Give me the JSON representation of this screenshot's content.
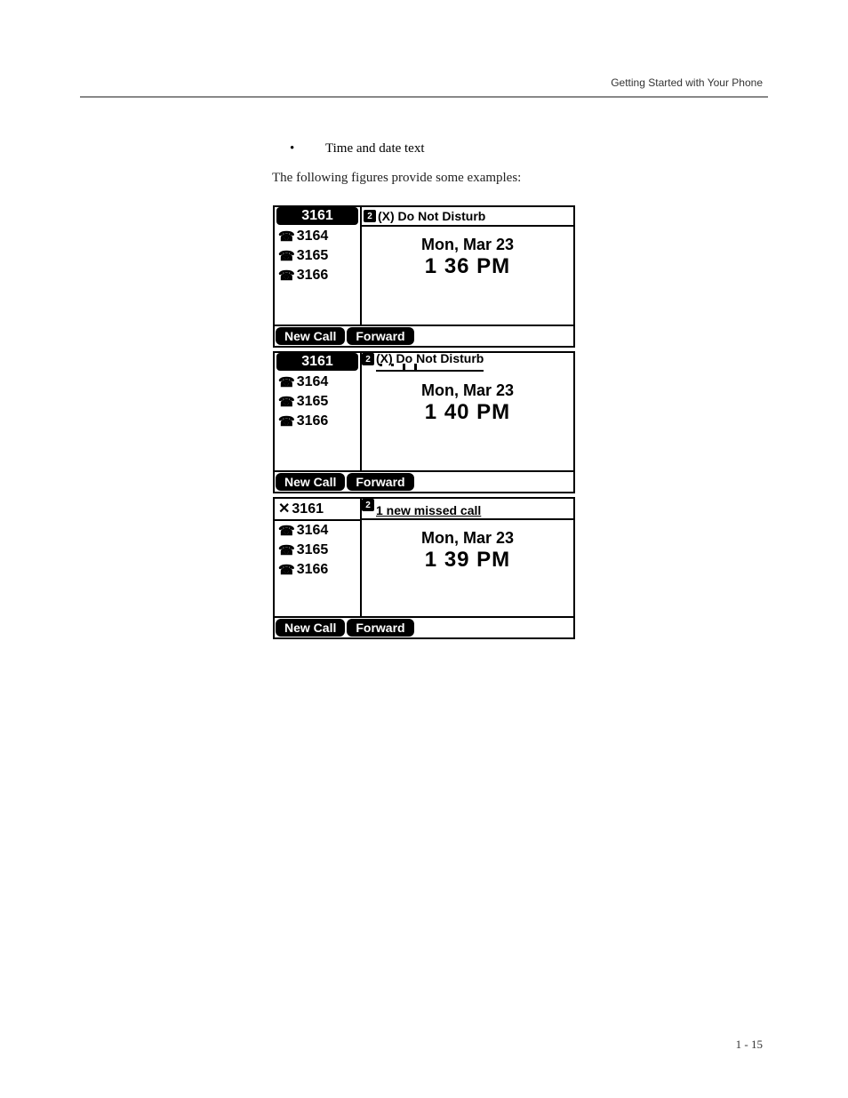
{
  "header": {
    "running_title": "Getting Started with Your Phone"
  },
  "bullet": {
    "item1": "Time and date text"
  },
  "intro": {
    "text": "The following figures provide some examples:"
  },
  "fig1": {
    "active_ext": "3161",
    "lines": [
      "3164",
      "3165",
      "3166"
    ],
    "status_badge": "2",
    "status_text": "(X) Do Not Disturb",
    "date": "Mon, Mar 23",
    "time": "1 36 PM",
    "softkeys": [
      "New Call",
      "Forward"
    ]
  },
  "fig2": {
    "active_ext": "3161",
    "lines": [
      "3164",
      "3165",
      "3166"
    ],
    "status_badge": "2",
    "scroll_text": "(X) Do Not Disturb",
    "date": "Mon, Mar 23",
    "time": "1 40 PM",
    "softkeys": [
      "New Call",
      "Forward"
    ]
  },
  "fig3": {
    "active_ext": "3161",
    "lines": [
      "3164",
      "3165",
      "3166"
    ],
    "status_badge": "2",
    "scroll_text": "1 new missed call",
    "date": "Mon, Mar 23",
    "time": "1 39 PM",
    "softkeys": [
      "New Call",
      "Forward"
    ]
  },
  "footer": {
    "page_number": "1 - 15"
  }
}
